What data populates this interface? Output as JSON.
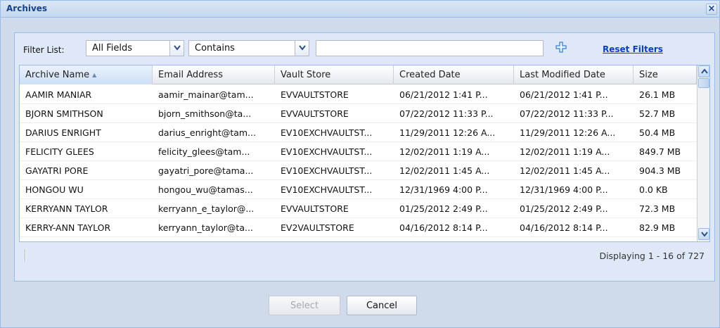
{
  "window": {
    "title": "Archives",
    "close_icon": "close-icon"
  },
  "filter": {
    "label": "Filter List:",
    "field_select": {
      "value": "All Fields"
    },
    "operator_select": {
      "value": "Contains"
    },
    "search_value": "",
    "add_icon": "plus-icon",
    "reset_label": "Reset Filters"
  },
  "grid": {
    "columns": [
      "Archive Name",
      "Email Address",
      "Vault Store",
      "Created Date",
      "Last Modified Date",
      "Size"
    ],
    "sort_indicator": "▲",
    "rows": [
      [
        "AAMIR MANIAR",
        "aamir_mainar@tam...",
        "EVVAULTSTORE",
        "06/21/2012 1:41 P...",
        "06/21/2012 1:41 P...",
        "26.1 MB"
      ],
      [
        "BJORN SMITHSON",
        "bjorn_smithson@ta...",
        "EVVAULTSTORE",
        "07/22/2012 11:33 P...",
        "07/22/2012 11:33 P...",
        "52.7 MB"
      ],
      [
        "DARIUS ENRIGHT",
        "darius_enright@tam...",
        "EV10EXCHVAULTST...",
        "11/29/2011 12:26 A...",
        "11/29/2011 12:26 A...",
        "50.4 MB"
      ],
      [
        "FELICITY GLEES",
        "felicity_glees@tam...",
        "EV10EXCHVAULTST...",
        "12/02/2011 1:19 A...",
        "12/02/2011 1:19 A...",
        "849.7 MB"
      ],
      [
        "GAYATRI PORE",
        "gayatri_pore@tama...",
        "EV10EXCHVAULTST...",
        "12/02/2011 1:45 A...",
        "12/02/2011 1:45 A...",
        "904.3 MB"
      ],
      [
        "HONGOU WU",
        "hongou_wu@tamas...",
        "EV10EXCHVAULTST...",
        "12/31/1969 4:00 P...",
        "12/31/1969 4:00 P...",
        "0.0 KB"
      ],
      [
        "KERRYANN TAYLOR",
        "kerryann_e_taylor@...",
        "EVVAULTSTORE",
        "01/25/2012 2:49 P...",
        "01/25/2012 2:49 P...",
        "72.3 MB"
      ],
      [
        "KERRY-ANN TAYLOR",
        "kerryann_taylor@ta...",
        "EV2VAULTSTORE",
        "04/16/2012 8:14 P...",
        "04/16/2012 8:14 P...",
        "82.9 MB"
      ]
    ]
  },
  "pager": {
    "info": "Displaying 1 - 16 of 727"
  },
  "buttons": {
    "select": "Select",
    "cancel": "Cancel"
  },
  "colors": {
    "title_text": "#15428b",
    "link": "#0b3fb8",
    "panel_bg": "#dfe8f6",
    "dialog_bg": "#cfdbea",
    "border": "#99bbe8"
  }
}
